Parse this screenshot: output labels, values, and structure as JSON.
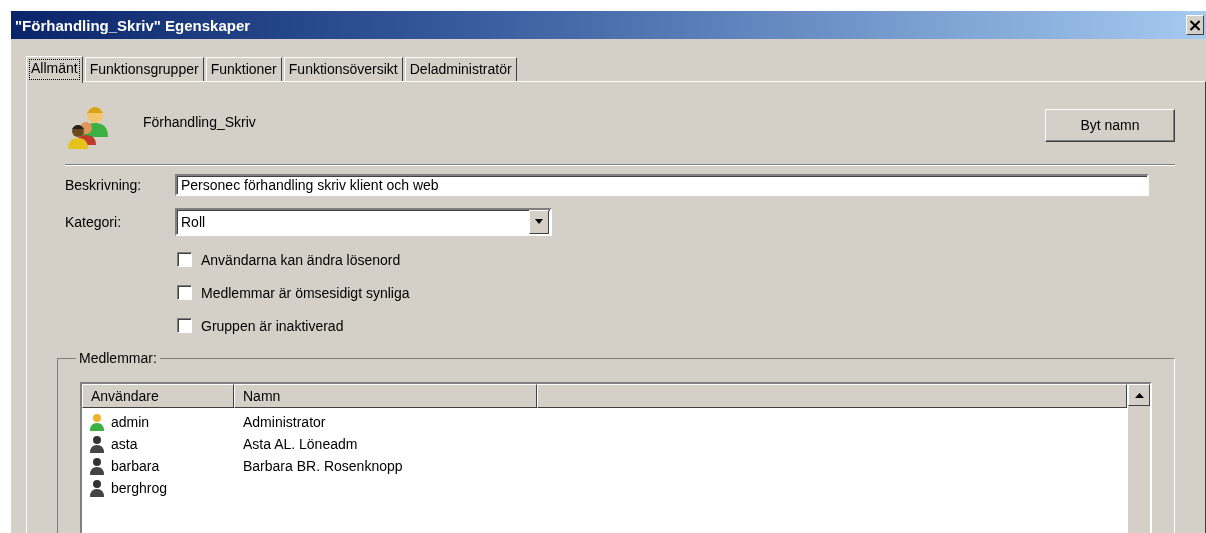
{
  "window": {
    "title": "\"Förhandling_Skriv\" Egenskaper",
    "close": "×"
  },
  "tabs": [
    {
      "label": "Allmänt",
      "selected": true
    },
    {
      "label": "Funktionsgrupper",
      "selected": false
    },
    {
      "label": "Funktioner",
      "selected": false
    },
    {
      "label": "Funktionsöversikt",
      "selected": false
    },
    {
      "label": "Deladministratör",
      "selected": false
    }
  ],
  "group_name": "Förhandling_Skriv",
  "rename_button": "Byt namn",
  "description": {
    "label": "Beskrivning:",
    "value": "Personec förhandling skriv klient och web"
  },
  "category": {
    "label": "Kategori:",
    "value": "Roll"
  },
  "options": [
    {
      "label": "Användarna kan ändra lösenord",
      "checked": false
    },
    {
      "label": "Medlemmar är ömsesidigt synliga",
      "checked": false
    },
    {
      "label": "Gruppen är inaktiverad",
      "checked": false
    }
  ],
  "members": {
    "title": "Medlemmar:",
    "columns": [
      "Användare",
      "Namn"
    ],
    "rows": [
      {
        "kind": "admin",
        "user": "admin",
        "name": "Administrator"
      },
      {
        "kind": "user",
        "user": "asta",
        "name": "Asta AL. Löneadm"
      },
      {
        "kind": "user",
        "user": "barbara",
        "name": "Barbara BR. Rosenknopp"
      },
      {
        "kind": "user",
        "user": "berghrog",
        "name": ""
      }
    ]
  }
}
